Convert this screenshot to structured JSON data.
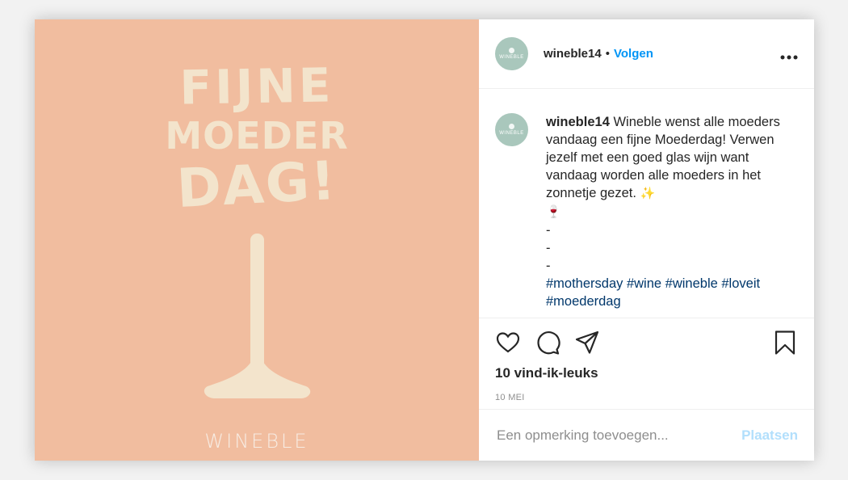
{
  "media": {
    "background_color": "#f1bd9f",
    "artwork_color": "#f3e4cc",
    "headline_lines": [
      "FIJNE",
      "MOEDER",
      "DAG!"
    ],
    "brand_logo": "WINEBLE"
  },
  "header": {
    "avatar_text": "WINEBLE",
    "username": "wineble14",
    "separator": "•",
    "follow_label": "Volgen",
    "more_icon": "more-horizontal-icon"
  },
  "caption": {
    "username": "wineble14",
    "text": "Wineble wenst alle moeders vandaag een fijne Moederdag! Verwen jezelf met een goed glas wijn want vandaag worden alle moeders in het zonnetje gezet.",
    "emoji_sparkle": "✨",
    "emoji_wine": "🍷",
    "dashes": [
      "-",
      "-",
      "-"
    ],
    "hashtags": "#mothersday #wine #wineble #loveit #moederdag"
  },
  "actions": {
    "icons": [
      "heart-icon",
      "comment-icon",
      "share-icon",
      "bookmark-icon"
    ],
    "likes": "10 vind-ik-leuks",
    "date": "10 MEI"
  },
  "comment": {
    "placeholder": "Een opmerking toevoegen...",
    "post_label": "Plaatsen",
    "post_color": "#b2dffc"
  },
  "colors": {
    "accent": "#0095f6",
    "hashtag": "#00376b",
    "avatar_bg": "#a9c7bc"
  }
}
